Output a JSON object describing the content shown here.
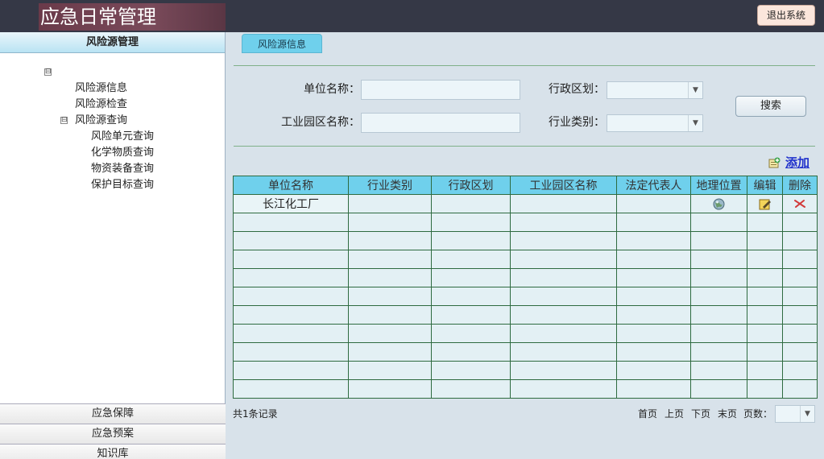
{
  "header": {
    "app_title": "应急日常管理",
    "logout_label": "退出系统"
  },
  "sidebar": {
    "title": "风险源管理",
    "tree": {
      "root_toggle": "⊟",
      "items": [
        {
          "label": "风险源信息"
        },
        {
          "label": "风险源检查"
        },
        {
          "label": "风险源查询",
          "toggle": "⊟",
          "children": [
            {
              "label": "风险单元查询"
            },
            {
              "label": "化学物质查询"
            },
            {
              "label": "物资装备查询"
            },
            {
              "label": "保护目标查询"
            }
          ]
        }
      ]
    },
    "sections": [
      {
        "label": "应急保障"
      },
      {
        "label": "应急预案"
      },
      {
        "label": "知识库"
      }
    ]
  },
  "main": {
    "tab_label": "风险源信息",
    "search": {
      "company_name_label": "单位名称：",
      "company_name_value": "",
      "district_label": "行政区划：",
      "district_value": "",
      "park_name_label": "工业园区名称：",
      "park_name_value": "",
      "industry_label": "行业类别：",
      "industry_value": "",
      "search_button": "搜索"
    },
    "add_label": "添加",
    "table": {
      "columns": [
        "单位名称",
        "行业类别",
        "行政区划",
        "工业园区名称",
        "法定代表人",
        "地理位置",
        "编辑",
        "删除"
      ],
      "rows": [
        {
          "company": "长江化工厂",
          "industry": "",
          "district": "",
          "park": "",
          "legal_rep": "",
          "location_icon": "globe-icon",
          "edit_icon": "edit-icon",
          "delete_icon": "delete-icon"
        }
      ]
    },
    "footer": {
      "record_count": "共1条记录",
      "first_page": "首页",
      "prev_page": "上页",
      "next_page": "下页",
      "last_page": "末页",
      "page_label": "页数：",
      "page_value": ""
    }
  },
  "colors": {
    "header_bg": "#353846",
    "table_header_bg": "#6fd0ec",
    "table_border": "#2e6b40",
    "add_link": "#2233cc"
  }
}
